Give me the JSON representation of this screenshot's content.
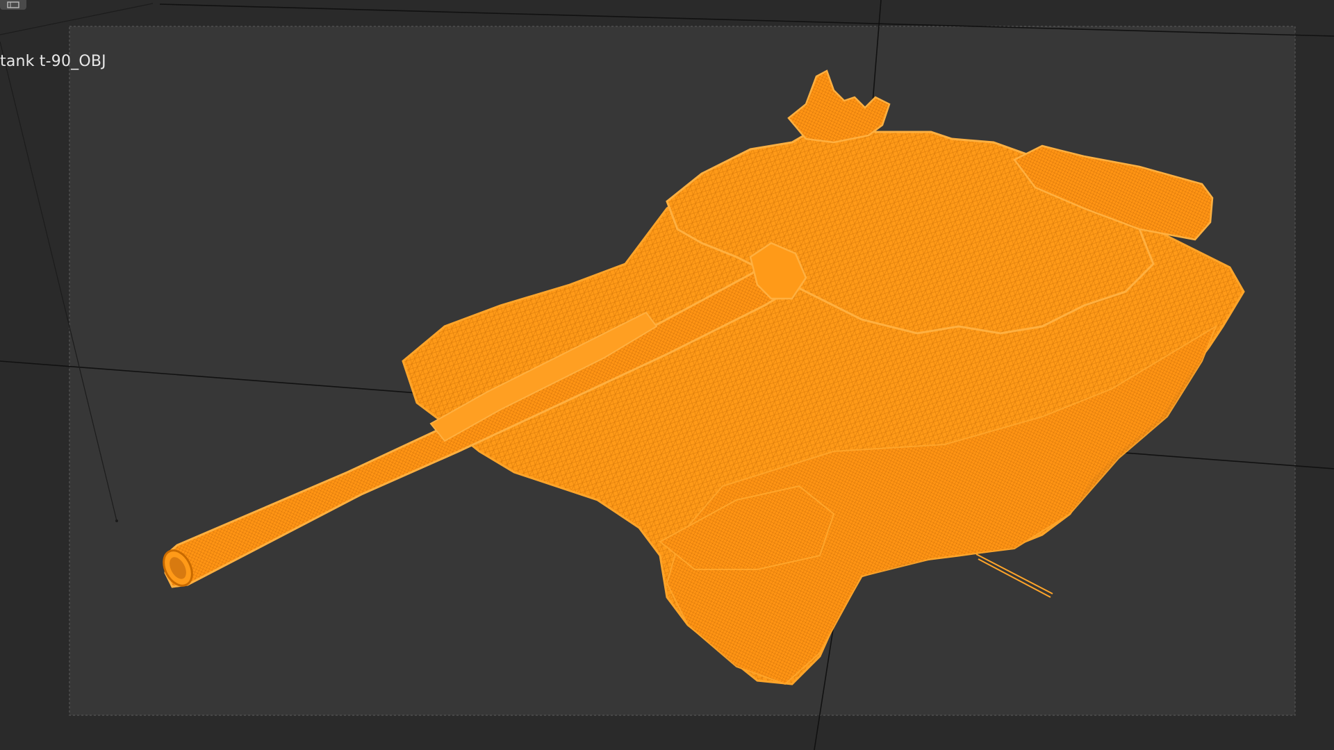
{
  "viewport": {
    "object_label": "tank t-90_OBJ",
    "background_color": "#2a2a2a",
    "safe_frame_color": "#363636",
    "mesh_color": "#ff9a18",
    "mesh_color_dark": "#c86a00",
    "grid_line_color": "#111111"
  },
  "corner_icon": "viewport-menu-icon"
}
